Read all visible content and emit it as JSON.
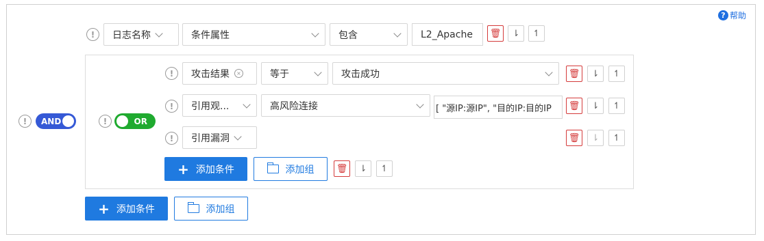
{
  "help": {
    "label": "帮助",
    "icon": "question-circle-icon"
  },
  "top_rule": {
    "field_type": "日志名称",
    "field": "条件属性",
    "operator": "包含",
    "value": "L2_Apache"
  },
  "root_toggle": {
    "label": "AND",
    "color": "#3559d6"
  },
  "group_toggle": {
    "label": "OR",
    "color": "#1faa2f"
  },
  "rules": [
    {
      "field": "攻击结果",
      "operator": "等于",
      "value": "攻击成功"
    },
    {
      "field": "引用观...",
      "operator": "高风险连接",
      "value": "[ \"源IP:源IP\", \"目的IP:目的IP"
    },
    {
      "field": "引用漏洞"
    }
  ],
  "buttons": {
    "add_condition": "添加条件",
    "add_group": "添加组"
  },
  "glyphs": {
    "warn": "!",
    "delete": "🗑",
    "up": "↿",
    "down": "⇂",
    "clear": "×",
    "help": "?"
  }
}
